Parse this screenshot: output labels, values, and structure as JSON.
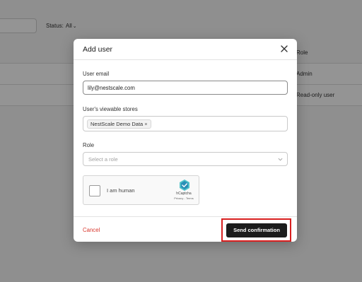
{
  "background": {
    "status_label": "Status:",
    "status_value": "All",
    "table_header_role": "Role",
    "rows": [
      {
        "role": "Admin"
      },
      {
        "role": "Read-only user"
      }
    ]
  },
  "modal": {
    "title": "Add user",
    "email": {
      "label": "User email",
      "value": "lily@nestscale.com"
    },
    "stores": {
      "label": "User's viewable stores",
      "chip": "NestScale Demo Data",
      "chip_remove": "×"
    },
    "role": {
      "label": "Role",
      "placeholder": "Select a role"
    },
    "captcha": {
      "label": "I am human",
      "brand": "hCaptcha",
      "links": "Privacy - Terms"
    },
    "footer": {
      "cancel_label": "Cancel",
      "send_label": "Send confirmation"
    }
  },
  "colors": {
    "cancel": "#d9382e",
    "primary_button": "#1c1c1c",
    "highlight_box": "#d81f1f",
    "overlay": "rgba(0,0,0,0.42)"
  }
}
